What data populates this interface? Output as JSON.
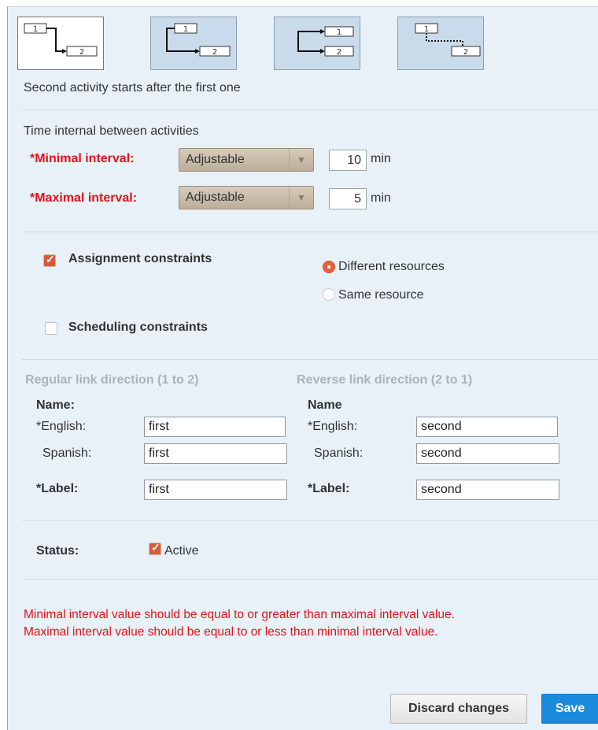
{
  "link_types": [
    {
      "name": "finish-to-start",
      "selected": true
    },
    {
      "name": "finish-to-finish",
      "selected": false
    },
    {
      "name": "start-to-start",
      "selected": false
    },
    {
      "name": "start-to-finish",
      "selected": false
    }
  ],
  "diagram_labels": {
    "first": "1",
    "second": "2"
  },
  "link_description": "Second activity starts after the first one",
  "interval": {
    "heading": "Time internal between activities",
    "minimal": {
      "label": "*Minimal interval:",
      "mode": "Adjustable",
      "value": "10",
      "unit": "min"
    },
    "maximal": {
      "label": "*Maximal interval:",
      "mode": "Adjustable",
      "value": "5",
      "unit": "min"
    }
  },
  "constraints": {
    "assignment": {
      "label": "Assignment constraints",
      "checked": true
    },
    "scheduling": {
      "label": "Scheduling constraints",
      "checked": false
    },
    "resource_options": [
      {
        "label": "Different resources",
        "selected": true
      },
      {
        "label": "Same resource",
        "selected": false
      }
    ]
  },
  "regular": {
    "heading": "Regular link direction (1 to 2)",
    "name_heading": "Name:",
    "english_label": "*English:",
    "english_value": "first",
    "spanish_label": "Spanish:",
    "spanish_value": "first",
    "label_label": "*Label:",
    "label_value": "first"
  },
  "reverse": {
    "heading": "Reverse link direction (2 to 1)",
    "name_heading": "Name",
    "english_label": "*English:",
    "english_value": "second",
    "spanish_label": "Spanish:",
    "spanish_value": "second",
    "label_label": "*Label:",
    "label_value": "second"
  },
  "status": {
    "label": "Status:",
    "active_label": "Active",
    "active": true
  },
  "errors": [
    "Minimal interval value should be equal to or greater than maximal interval value.",
    "Maximal interval value should be equal to or less than minimal interval value."
  ],
  "buttons": {
    "discard": "Discard changes",
    "save": "Save"
  },
  "colors": {
    "error": "#e3131b",
    "save": "#1a8bdc",
    "checkbox_on": "#d95a39"
  }
}
